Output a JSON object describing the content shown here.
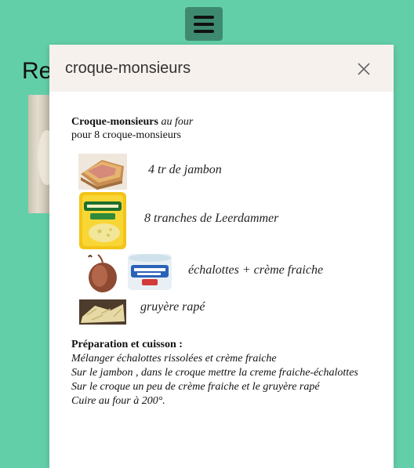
{
  "background": {
    "title_fragment": "Re"
  },
  "modal": {
    "title": "croque-monsieurs",
    "recipe_name": "Croque-monsieurs",
    "recipe_mode": "au four",
    "yield": "pour 8 croque-monsieurs",
    "ingredients": [
      {
        "label": "4 tr de jambon",
        "icon": "ham-image"
      },
      {
        "label": "8 tranches de Leerdammer",
        "icon": "leerdammer-package-image"
      },
      {
        "label": "échalottes + crème fraiche",
        "icon": "shallot-and-cream-image"
      },
      {
        "label": "gruyère rapé",
        "icon": "grated-cheese-image"
      }
    ],
    "preparation_heading": "Préparation et cuisson :",
    "steps": [
      "Mélanger échalottes rissolées et crème fraiche",
      "Sur le jambon , dans le croque mettre la creme fraiche-échalottes",
      "Sur le croque un peu de crème fraiche et le gruyère rapé",
      "Cuire au four à 200°."
    ]
  },
  "colors": {
    "page_background": "#63cfa9",
    "menu_button": "#3e8a70",
    "modal_header": "#f6f1ed"
  }
}
